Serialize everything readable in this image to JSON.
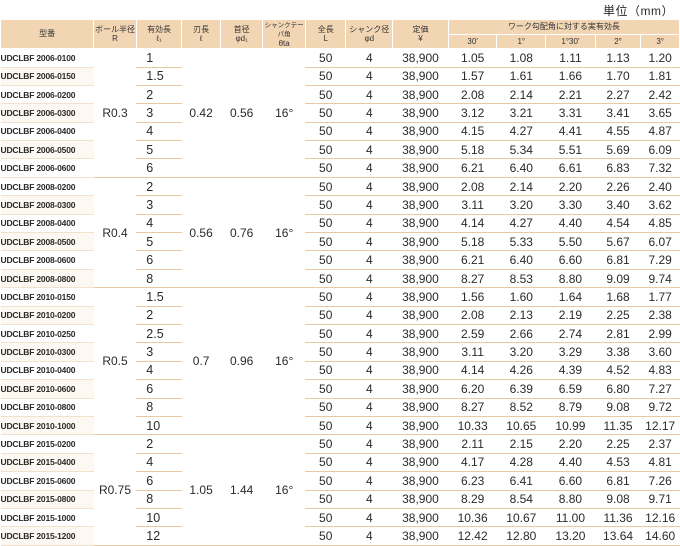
{
  "unit_label": "単位（mm）",
  "headers": {
    "model": "型番",
    "ball_radius": [
      "ボール半径",
      "R"
    ],
    "effective_length": [
      "有効長",
      "ℓ₁"
    ],
    "blade_length": [
      "刃長",
      "ℓ"
    ],
    "neck_diameter": [
      "首径",
      "φd₁"
    ],
    "shank_taper": [
      "シャンクテーパ角",
      "θta"
    ],
    "overall_length": [
      "全長",
      "L"
    ],
    "shank_diameter": [
      "シャンク径",
      "φd"
    ],
    "price": [
      "定価",
      "¥"
    ],
    "actual_length_title": "ワーク勾配角に対する実有効長",
    "angles": [
      "30'",
      "1°",
      "1°30'",
      "2°",
      "3°"
    ]
  },
  "groups": [
    {
      "radius": "R0.3",
      "blade": "0.42",
      "neck": "0.56",
      "taper": "16°",
      "rows": [
        {
          "model": "UDCLBF 2006-0100",
          "eff": "1",
          "L": "50",
          "d": "4",
          "price": "38,900",
          "vals": [
            "1.05",
            "1.08",
            "1.11",
            "1.13",
            "1.20"
          ]
        },
        {
          "model": "UDCLBF 2006-0150",
          "eff": "1.5",
          "L": "50",
          "d": "4",
          "price": "38,900",
          "vals": [
            "1.57",
            "1.61",
            "1.66",
            "1.70",
            "1.81"
          ]
        },
        {
          "model": "UDCLBF 2006-0200",
          "eff": "2",
          "L": "50",
          "d": "4",
          "price": "38,900",
          "vals": [
            "2.08",
            "2.14",
            "2.21",
            "2.27",
            "2.42"
          ]
        },
        {
          "model": "UDCLBF 2006-0300",
          "eff": "3",
          "L": "50",
          "d": "4",
          "price": "38,900",
          "vals": [
            "3.12",
            "3.21",
            "3.31",
            "3.41",
            "3.65"
          ]
        },
        {
          "model": "UDCLBF 2006-0400",
          "eff": "4",
          "L": "50",
          "d": "4",
          "price": "38,900",
          "vals": [
            "4.15",
            "4.27",
            "4.41",
            "4.55",
            "4.87"
          ]
        },
        {
          "model": "UDCLBF 2006-0500",
          "eff": "5",
          "L": "50",
          "d": "4",
          "price": "38,900",
          "vals": [
            "5.18",
            "5.34",
            "5.51",
            "5.69",
            "6.09"
          ]
        },
        {
          "model": "UDCLBF 2006-0600",
          "eff": "6",
          "L": "50",
          "d": "4",
          "price": "38,900",
          "vals": [
            "6.21",
            "6.40",
            "6.61",
            "6.83",
            "7.32"
          ]
        }
      ]
    },
    {
      "radius": "R0.4",
      "blade": "0.56",
      "neck": "0.76",
      "taper": "16°",
      "rows": [
        {
          "model": "UDCLBF 2008-0200",
          "eff": "2",
          "L": "50",
          "d": "4",
          "price": "38,900",
          "vals": [
            "2.08",
            "2.14",
            "2.20",
            "2.26",
            "2.40"
          ]
        },
        {
          "model": "UDCLBF 2008-0300",
          "eff": "3",
          "L": "50",
          "d": "4",
          "price": "38,900",
          "vals": [
            "3.11",
            "3.20",
            "3.30",
            "3.40",
            "3.62"
          ]
        },
        {
          "model": "UDCLBF 2008-0400",
          "eff": "4",
          "L": "50",
          "d": "4",
          "price": "38,900",
          "vals": [
            "4.14",
            "4.27",
            "4.40",
            "4.54",
            "4.85"
          ]
        },
        {
          "model": "UDCLBF 2008-0500",
          "eff": "5",
          "L": "50",
          "d": "4",
          "price": "38,900",
          "vals": [
            "5.18",
            "5.33",
            "5.50",
            "5.67",
            "6.07"
          ]
        },
        {
          "model": "UDCLBF 2008-0600",
          "eff": "6",
          "L": "50",
          "d": "4",
          "price": "38,900",
          "vals": [
            "6.21",
            "6.40",
            "6.60",
            "6.81",
            "7.29"
          ]
        },
        {
          "model": "UDCLBF 2008-0800",
          "eff": "8",
          "L": "50",
          "d": "4",
          "price": "38,900",
          "vals": [
            "8.27",
            "8.53",
            "8.80",
            "9.09",
            "9.74"
          ]
        }
      ]
    },
    {
      "radius": "R0.5",
      "blade": "0.7",
      "neck": "0.96",
      "taper": "16°",
      "rows": [
        {
          "model": "UDCLBF 2010-0150",
          "eff": "1.5",
          "L": "50",
          "d": "4",
          "price": "38,900",
          "vals": [
            "1.56",
            "1.60",
            "1.64",
            "1.68",
            "1.77"
          ]
        },
        {
          "model": "UDCLBF 2010-0200",
          "eff": "2",
          "L": "50",
          "d": "4",
          "price": "38,900",
          "vals": [
            "2.08",
            "2.13",
            "2.19",
            "2.25",
            "2.38"
          ]
        },
        {
          "model": "UDCLBF 2010-0250",
          "eff": "2.5",
          "L": "50",
          "d": "4",
          "price": "38,900",
          "vals": [
            "2.59",
            "2.66",
            "2.74",
            "2.81",
            "2.99"
          ]
        },
        {
          "model": "UDCLBF 2010-0300",
          "eff": "3",
          "L": "50",
          "d": "4",
          "price": "38,900",
          "vals": [
            "3.11",
            "3.20",
            "3.29",
            "3.38",
            "3.60"
          ]
        },
        {
          "model": "UDCLBF 2010-0400",
          "eff": "4",
          "L": "50",
          "d": "4",
          "price": "38,900",
          "vals": [
            "4.14",
            "4.26",
            "4.39",
            "4.52",
            "4.83"
          ]
        },
        {
          "model": "UDCLBF 2010-0600",
          "eff": "6",
          "L": "50",
          "d": "4",
          "price": "38,900",
          "vals": [
            "6.20",
            "6.39",
            "6.59",
            "6.80",
            "7.27"
          ]
        },
        {
          "model": "UDCLBF 2010-0800",
          "eff": "8",
          "L": "50",
          "d": "4",
          "price": "38,900",
          "vals": [
            "8.27",
            "8.52",
            "8.79",
            "9.08",
            "9.72"
          ]
        },
        {
          "model": "UDCLBF 2010-1000",
          "eff": "10",
          "L": "50",
          "d": "4",
          "price": "38,900",
          "vals": [
            "10.33",
            "10.65",
            "10.99",
            "11.35",
            "12.17"
          ]
        }
      ]
    },
    {
      "radius": "R0.75",
      "blade": "1.05",
      "neck": "1.44",
      "taper": "16°",
      "rows": [
        {
          "model": "UDCLBF 2015-0200",
          "eff": "2",
          "L": "50",
          "d": "4",
          "price": "38,900",
          "vals": [
            "2.11",
            "2.15",
            "2.20",
            "2.25",
            "2.37"
          ]
        },
        {
          "model": "UDCLBF 2015-0400",
          "eff": "4",
          "L": "50",
          "d": "4",
          "price": "38,900",
          "vals": [
            "4.17",
            "4.28",
            "4.40",
            "4.53",
            "4.81"
          ]
        },
        {
          "model": "UDCLBF 2015-0600",
          "eff": "6",
          "L": "50",
          "d": "4",
          "price": "38,900",
          "vals": [
            "6.23",
            "6.41",
            "6.60",
            "6.81",
            "7.26"
          ]
        },
        {
          "model": "UDCLBF 2015-0800",
          "eff": "8",
          "L": "50",
          "d": "4",
          "price": "38,900",
          "vals": [
            "8.29",
            "8.54",
            "8.80",
            "9.08",
            "9.71"
          ]
        },
        {
          "model": "UDCLBF 2015-1000",
          "eff": "10",
          "L": "50",
          "d": "4",
          "price": "38,900",
          "vals": [
            "10.36",
            "10.67",
            "11.00",
            "11.36",
            "12.16"
          ]
        },
        {
          "model": "UDCLBF 2015-1200",
          "eff": "12",
          "L": "50",
          "d": "4",
          "price": "38,900",
          "vals": [
            "12.42",
            "12.80",
            "13.20",
            "13.64",
            "14.60"
          ]
        }
      ]
    }
  ]
}
